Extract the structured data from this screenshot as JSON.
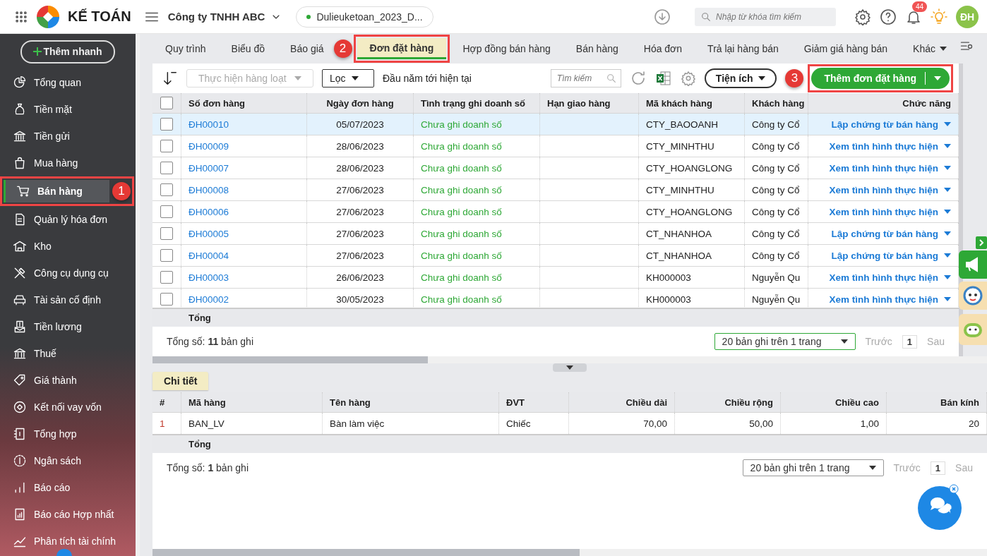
{
  "topbar": {
    "app_name": "KẾ TOÁN",
    "company": "Công ty TNHH ABC",
    "database": "Dulieuketoan_2023_D...",
    "search": {
      "placeholder": "Nhập từ khóa tìm kiếm"
    },
    "notification_count": "44",
    "avatar": "ĐH"
  },
  "sidebar": {
    "quick_add": "Thêm nhanh",
    "items": [
      {
        "label": "Tổng quan",
        "selected": false
      },
      {
        "label": "Tiền mặt",
        "selected": false
      },
      {
        "label": "Tiền gửi",
        "selected": false
      },
      {
        "label": "Mua hàng",
        "selected": false
      },
      {
        "label": "Bán hàng",
        "selected": true,
        "callout": "1"
      },
      {
        "label": "Quản lý hóa đơn",
        "selected": false
      },
      {
        "label": "Kho",
        "selected": false
      },
      {
        "label": "Công cụ dụng cụ",
        "selected": false
      },
      {
        "label": "Tài sản cố định",
        "selected": false
      },
      {
        "label": "Tiền lương",
        "selected": false
      },
      {
        "label": "Thuế",
        "selected": false
      },
      {
        "label": "Giá thành",
        "selected": false
      },
      {
        "label": "Kết nối vay vốn",
        "selected": false
      },
      {
        "label": "Tổng hợp",
        "selected": false
      },
      {
        "label": "Ngân sách",
        "selected": false
      },
      {
        "label": "Báo cáo",
        "selected": false
      },
      {
        "label": "Báo cáo Hợp nhất",
        "selected": false
      },
      {
        "label": "Phân tích tài chính",
        "selected": false
      }
    ]
  },
  "tabs": {
    "items": [
      {
        "label": "Quy trình",
        "kind": "tab",
        "selected": false
      },
      {
        "label": "Biểu đồ",
        "kind": "tab",
        "selected": false
      },
      {
        "label": "Báo giá",
        "kind": "tab",
        "selected": false
      },
      {
        "label": "Đơn đặt hàng",
        "kind": "tab",
        "selected": true,
        "callout": "2"
      },
      {
        "label": "Hợp đồng bán hàng",
        "kind": "tab",
        "selected": false
      },
      {
        "label": "Bán hàng",
        "kind": "tab",
        "selected": false
      },
      {
        "label": "Hóa đơn",
        "kind": "tab",
        "selected": false
      },
      {
        "label": "Trả lại hàng bán",
        "kind": "tab",
        "selected": false
      },
      {
        "label": "Giảm giá hàng bán",
        "kind": "tab",
        "selected": false
      },
      {
        "label": "Khác",
        "kind": "menu",
        "selected": false
      }
    ]
  },
  "toolbar": {
    "batch_action": {
      "label": "Thực hiện hàng loạt",
      "disabled": true
    },
    "filter": "Lọc",
    "period": "Đầu năm tới hiện tại",
    "search": {
      "placeholder": "Tìm kiếm"
    },
    "utilities": "Tiện ích",
    "primary_button": {
      "label": "Thêm đơn đặt hàng",
      "callout": "3"
    }
  },
  "main_table": {
    "columns": [
      "Số đơn hàng",
      "Ngày đơn hàng",
      "Tình trạng ghi doanh số",
      "Hạn giao hàng",
      "Mã khách hàng",
      "Khách hàng",
      "Chức năng"
    ],
    "header_checked": false,
    "rows": [
      {
        "selected": true,
        "checked": false,
        "order_no": "ĐH00010",
        "date": "05/07/2023",
        "status": "Chưa ghi doanh số",
        "customer_code": "CTY_BAOOANH",
        "customer": "Công ty Cổ",
        "action": "Lập chứng từ bán hàng"
      },
      {
        "selected": false,
        "checked": false,
        "order_no": "ĐH00009",
        "date": "28/06/2023",
        "status": "Chưa ghi doanh số",
        "customer_code": "CTY_MINHTHU",
        "customer": "Công ty Cổ",
        "action": "Xem tình hình thực hiện"
      },
      {
        "selected": false,
        "checked": false,
        "order_no": "ĐH00007",
        "date": "28/06/2023",
        "status": "Chưa ghi doanh số",
        "customer_code": "CTY_HOANGLONG",
        "customer": "Công ty Cổ",
        "action": "Xem tình hình thực hiện"
      },
      {
        "selected": false,
        "checked": false,
        "order_no": "ĐH00008",
        "date": "27/06/2023",
        "status": "Chưa ghi doanh số",
        "customer_code": "CTY_MINHTHU",
        "customer": "Công ty Cổ",
        "action": "Xem tình hình thực hiện"
      },
      {
        "selected": false,
        "checked": false,
        "order_no": "ĐH00006",
        "date": "27/06/2023",
        "status": "Chưa ghi doanh số",
        "customer_code": "CTY_HOANGLONG",
        "customer": "Công ty Cổ",
        "action": "Xem tình hình thực hiện"
      },
      {
        "selected": false,
        "checked": false,
        "order_no": "ĐH00005",
        "date": "27/06/2023",
        "status": "Chưa ghi doanh số",
        "customer_code": "CT_NHANHOA",
        "customer": "Công ty Cổ",
        "action": "Lập chứng từ bán hàng"
      },
      {
        "selected": false,
        "checked": false,
        "order_no": "ĐH00004",
        "date": "27/06/2023",
        "status": "Chưa ghi doanh số",
        "customer_code": "CT_NHANHOA",
        "customer": "Công ty Cổ",
        "action": "Lập chứng từ bán hàng"
      },
      {
        "selected": false,
        "checked": false,
        "order_no": "ĐH00003",
        "date": "26/06/2023",
        "status": "Chưa ghi doanh số",
        "customer_code": "KH000003",
        "customer": "Nguyễn Qu",
        "action": "Xem tình hình thực hiện"
      },
      {
        "selected": false,
        "checked": false,
        "order_no": "ĐH00002",
        "date": "30/05/2023",
        "status": "Chưa ghi doanh số",
        "customer_code": "KH000003",
        "customer": "Nguyễn Qu",
        "action": "Xem tình hình thực hiện"
      }
    ],
    "total_label": "Tổng",
    "pager": {
      "summary": "Tổng số: **11** bản ghi",
      "page_size": "20 bản ghi trên 1 trang",
      "previous": "Trước",
      "page": "1",
      "next": "Sau"
    }
  },
  "detail": {
    "tab": "Chi tiết",
    "columns": [
      "#",
      "Mã hàng",
      "Tên hàng",
      "ĐVT",
      "Chiều dài",
      "Chiều rộng",
      "Chiều cao",
      "Bán kính"
    ],
    "rows": [
      {
        "cells": [
          "1",
          "BAN_LV",
          "Bàn làm việc",
          "Chiếc",
          "70,00",
          "50,00",
          "1,00",
          "20"
        ]
      }
    ],
    "total_label": "Tổng",
    "pager": {
      "summary": "Tổng số: **1** bản ghi",
      "page_size": "20 bản ghi trên 1 trang",
      "previous": "Trước",
      "page": "1",
      "next": "Sau"
    }
  }
}
